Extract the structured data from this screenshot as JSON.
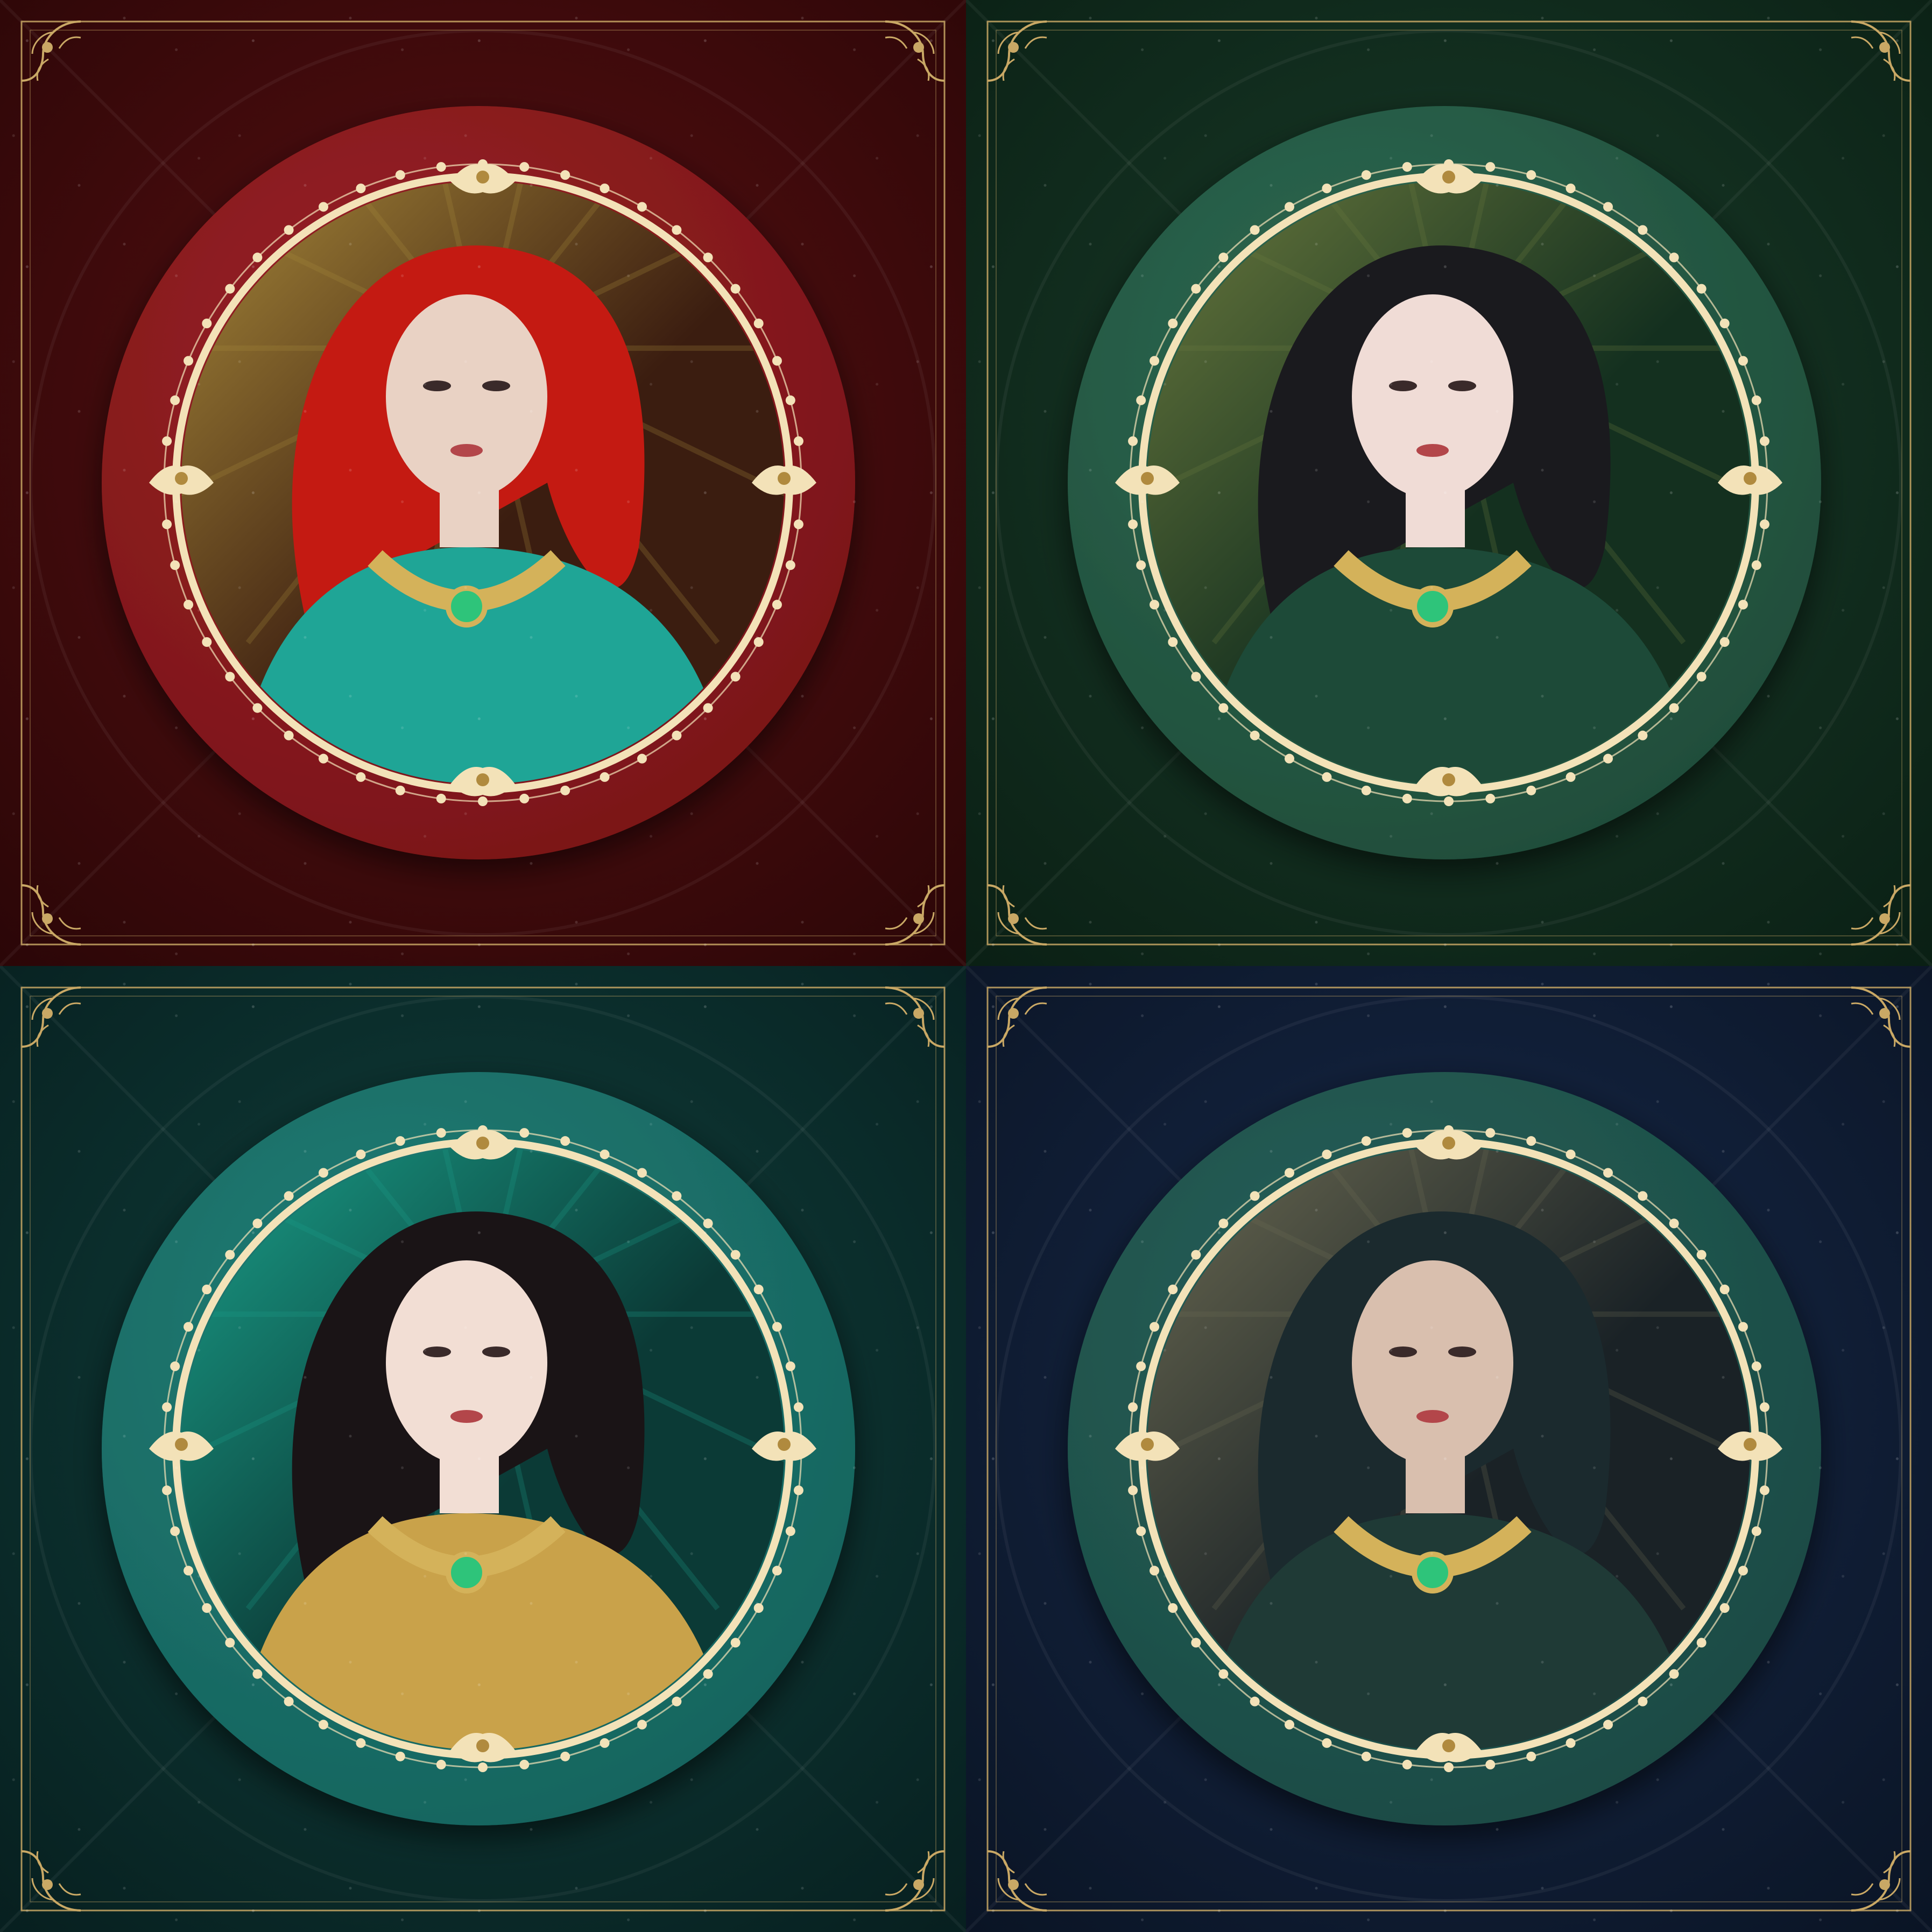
{
  "cards": [
    {
      "id": "red",
      "icon": "portrait-red-haired-archer",
      "bg_dark": "#2a0607",
      "bg_light": "#5a1012",
      "ring": "#7a1518",
      "ring_light": "#9a2226",
      "art_a": "#3b1d10",
      "art_b": "#a88a3a",
      "accent": "#c41a12",
      "skin": "#e9d2c4",
      "garment": "#1fa596"
    },
    {
      "id": "green",
      "icon": "portrait-dark-haired-flower-maiden",
      "bg_dark": "#0a1f14",
      "bg_light": "#1a3d2a",
      "ring": "#1f4d3a",
      "ring_light": "#2e6a52",
      "art_a": "#14301f",
      "art_b": "#6b7a3e",
      "accent": "#1a1a1e",
      "skin": "#f0dcd6",
      "garment": "#1d4a38"
    },
    {
      "id": "teal",
      "icon": "portrait-dark-haired-gold-leaf-maiden",
      "bg_dark": "#071f1f",
      "bg_light": "#10403c",
      "ring": "#17645e",
      "ring_light": "#1f7e76",
      "art_a": "#0b3a36",
      "art_b": "#1aa08a",
      "accent": "#1a1416",
      "skin": "#f2ded4",
      "garment": "#c9a24a"
    },
    {
      "id": "navy",
      "icon": "portrait-hooded-sorceress",
      "bg_dark": "#0a1424",
      "bg_light": "#17294a",
      "ring": "#1c4a44",
      "ring_light": "#25625a",
      "art_a": "#1a2226",
      "art_b": "#6b6a52",
      "accent": "#1b2a2e",
      "skin": "#d9bfae",
      "garment": "#1f3a36"
    }
  ],
  "frame_gold": "#c9a865",
  "frame_cream": "#f3e2b8"
}
